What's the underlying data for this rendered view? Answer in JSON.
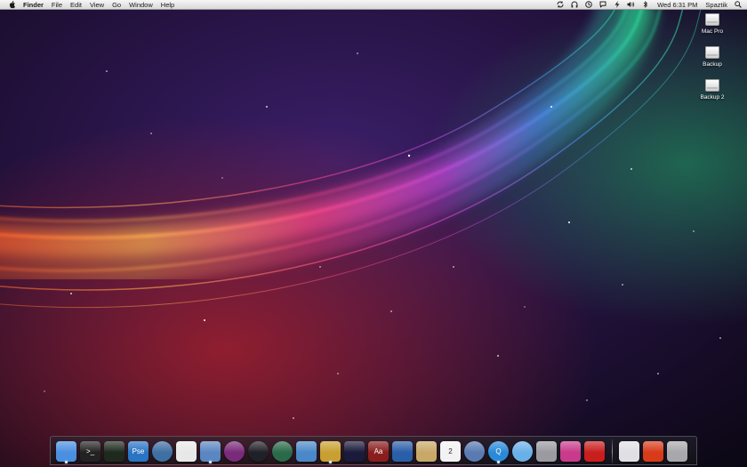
{
  "menubar": {
    "apple_icon": "apple-logo-icon",
    "app_name": "Finder",
    "menus": [
      "File",
      "Edit",
      "View",
      "Go",
      "Window",
      "Help"
    ],
    "status_icons": [
      "sync-icon",
      "headphones-icon",
      "clock-icon",
      "chat-icon",
      "lightning-icon",
      "volume-icon",
      "bluetooth-icon"
    ],
    "clock": "Wed 6:31 PM",
    "user": "Spaztik",
    "spotlight_icon": "spotlight-search-icon"
  },
  "desktop_icons": [
    {
      "label": "Mac Pro",
      "icon": "hard-drive-icon"
    },
    {
      "label": "Backup",
      "icon": "hard-drive-icon"
    },
    {
      "label": "Backup 2",
      "icon": "hard-drive-icon"
    }
  ],
  "dock": {
    "apps": [
      {
        "name": "finder-icon",
        "color": "#4a8fe0",
        "text": ""
      },
      {
        "name": "terminal-icon",
        "color": "#222222",
        "text": ">_"
      },
      {
        "name": "activity-monitor-icon",
        "color": "#1e2a1e",
        "text": ""
      },
      {
        "name": "photoshop-elements-icon",
        "color": "#2a74c4",
        "text": "Pse"
      },
      {
        "name": "safari-icon",
        "color": "#3f6fa3",
        "text": ""
      },
      {
        "name": "textedit-icon",
        "color": "#e8e8e8",
        "text": ""
      },
      {
        "name": "preview-icon",
        "color": "#5a86c2",
        "text": ""
      },
      {
        "name": "itunes-visualizer-icon",
        "color": "#7a2a7a",
        "text": ""
      },
      {
        "name": "aperture-icon",
        "color": "#202028",
        "text": ""
      },
      {
        "name": "time-machine-icon",
        "color": "#2a6a4a",
        "text": ""
      },
      {
        "name": "iphoto-icon",
        "color": "#4a88c8",
        "text": ""
      },
      {
        "name": "iwork-icon",
        "color": "#c8a032",
        "text": ""
      },
      {
        "name": "final-cut-icon",
        "color": "#1a1a3a",
        "text": ""
      },
      {
        "name": "dictionary-icon",
        "color": "#8a1e1e",
        "text": "Aa"
      },
      {
        "name": "remote-desktop-icon",
        "color": "#2a5ea8",
        "text": ""
      },
      {
        "name": "notes-icon",
        "color": "#c8a868",
        "text": ""
      },
      {
        "name": "calendar-icon",
        "color": "#f2f2f2",
        "text": "2"
      },
      {
        "name": "facetime-icon",
        "color": "#5a7ab2",
        "text": ""
      },
      {
        "name": "quicktime-icon",
        "color": "#2a8ad8",
        "text": "Q"
      },
      {
        "name": "itunes-icon",
        "color": "#6ab0e8",
        "text": ""
      },
      {
        "name": "system-profiler-icon",
        "color": "#9a9aa0",
        "text": ""
      },
      {
        "name": "photo-booth-icon",
        "color": "#c83a8a",
        "text": ""
      },
      {
        "name": "front-row-icon",
        "color": "#c81e1e",
        "text": ""
      },
      {
        "name": "documents-stack-icon",
        "color": "#e0e0e4",
        "text": ""
      },
      {
        "name": "downloads-stack-icon",
        "color": "#d83a1a",
        "text": ""
      },
      {
        "name": "trash-icon",
        "color": "#a8a8ac",
        "text": ""
      }
    ]
  }
}
